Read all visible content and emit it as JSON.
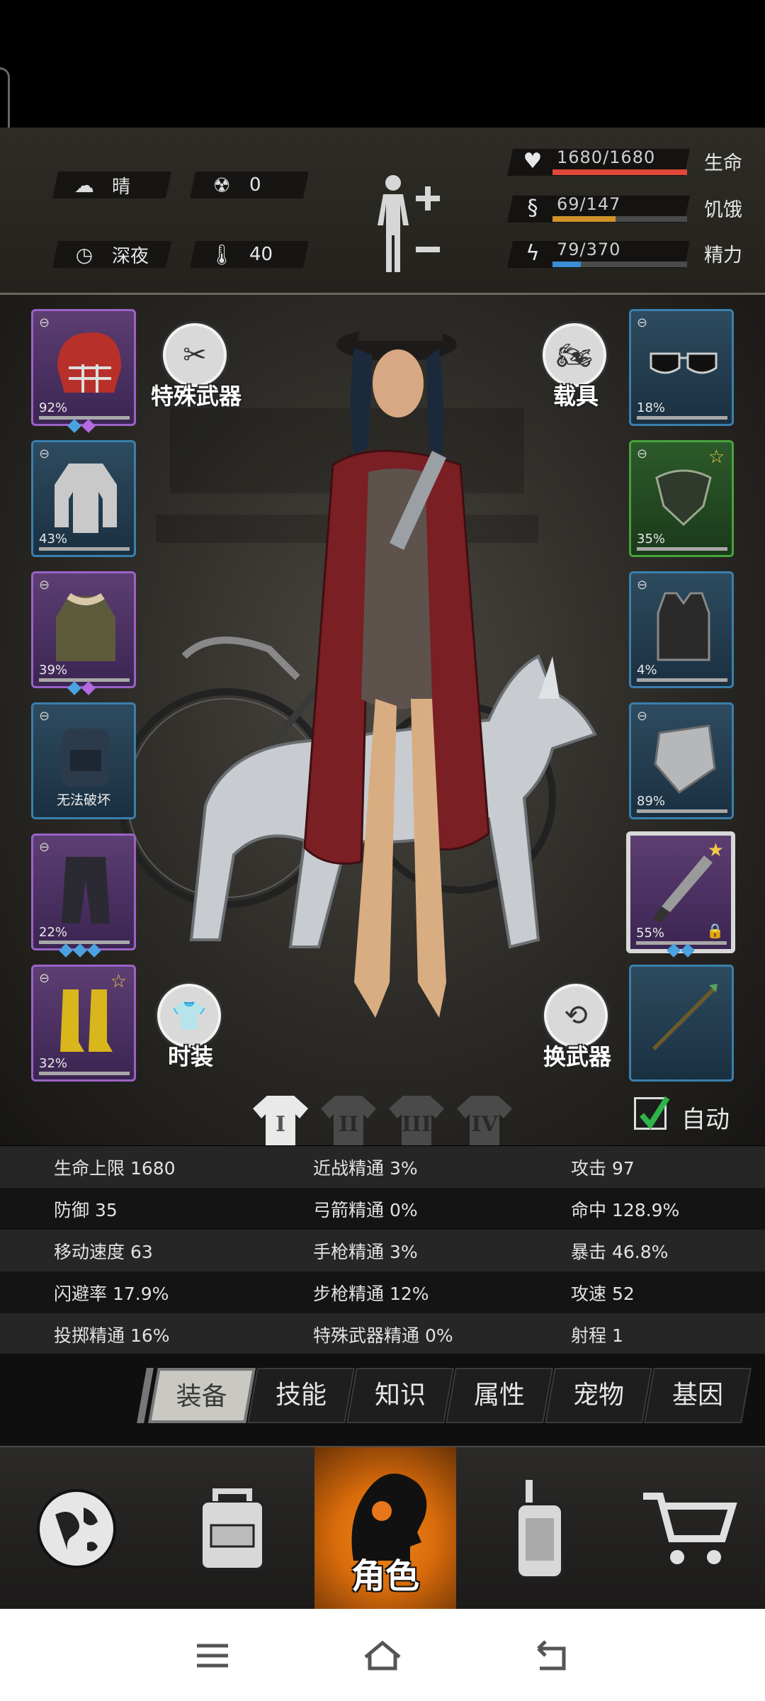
{
  "status": {
    "weather": "晴",
    "radiation": "0",
    "time_of_day": "深夜",
    "temperature": "40",
    "hp": {
      "text": "1680/1680",
      "label": "生命",
      "fraction": 1.0,
      "color": "#e0483a"
    },
    "hunger": {
      "text": "69/147",
      "label": "饥饿",
      "fraction": 0.47,
      "color": "#d1922a"
    },
    "energy": {
      "text": "79/370",
      "label": "精力",
      "fraction": 0.21,
      "color": "#3b8dd8"
    }
  },
  "left_slots": [
    {
      "name": "helmet",
      "pct": "92%",
      "gems": [
        "#4aa3e0",
        "#b46ae0"
      ]
    },
    {
      "name": "shirt",
      "pct": "43%",
      "gems": []
    },
    {
      "name": "coat",
      "pct": "39%",
      "gems": [
        "#4aa3e0",
        "#b46ae0"
      ]
    },
    {
      "name": "backpack",
      "pct": "",
      "special": "无法破坏",
      "gems": []
    },
    {
      "name": "pants",
      "pct": "22%",
      "gems": [
        "#4aa3e0",
        "#4aa3e0",
        "#4aa3e0"
      ]
    },
    {
      "name": "boots",
      "pct": "32%",
      "gems": []
    }
  ],
  "right_slots": [
    {
      "name": "sunglasses",
      "pct": "18%"
    },
    {
      "name": "gas-mask",
      "pct": "35%"
    },
    {
      "name": "vest",
      "pct": "4%"
    },
    {
      "name": "shield",
      "pct": "89%"
    },
    {
      "name": "machete",
      "pct": "55%"
    },
    {
      "name": "spear",
      "pct": ""
    }
  ],
  "buttons": {
    "special_weapon": "特殊武器",
    "vehicle": "载具",
    "fashion": "时装",
    "swap_weapon": "换武器"
  },
  "outfit_tabs": [
    "I",
    "II",
    "III",
    "IV"
  ],
  "auto_label": "自动",
  "attributes": [
    [
      "生命上限 1680",
      "近战精通 3%",
      "攻击 97"
    ],
    [
      "防御 35",
      "弓箭精通 0%",
      "命中 128.9%"
    ],
    [
      "移动速度 63",
      "手枪精通 3%",
      "暴击 46.8%"
    ],
    [
      "闪避率 17.9%",
      "步枪精通 12%",
      "攻速 52"
    ],
    [
      "投掷精通 16%",
      "特殊武器精通 0%",
      "射程 1"
    ]
  ],
  "tabs": [
    "装备",
    "技能",
    "知识",
    "属性",
    "宠物",
    "基因"
  ],
  "nav": {
    "character": "角色"
  }
}
